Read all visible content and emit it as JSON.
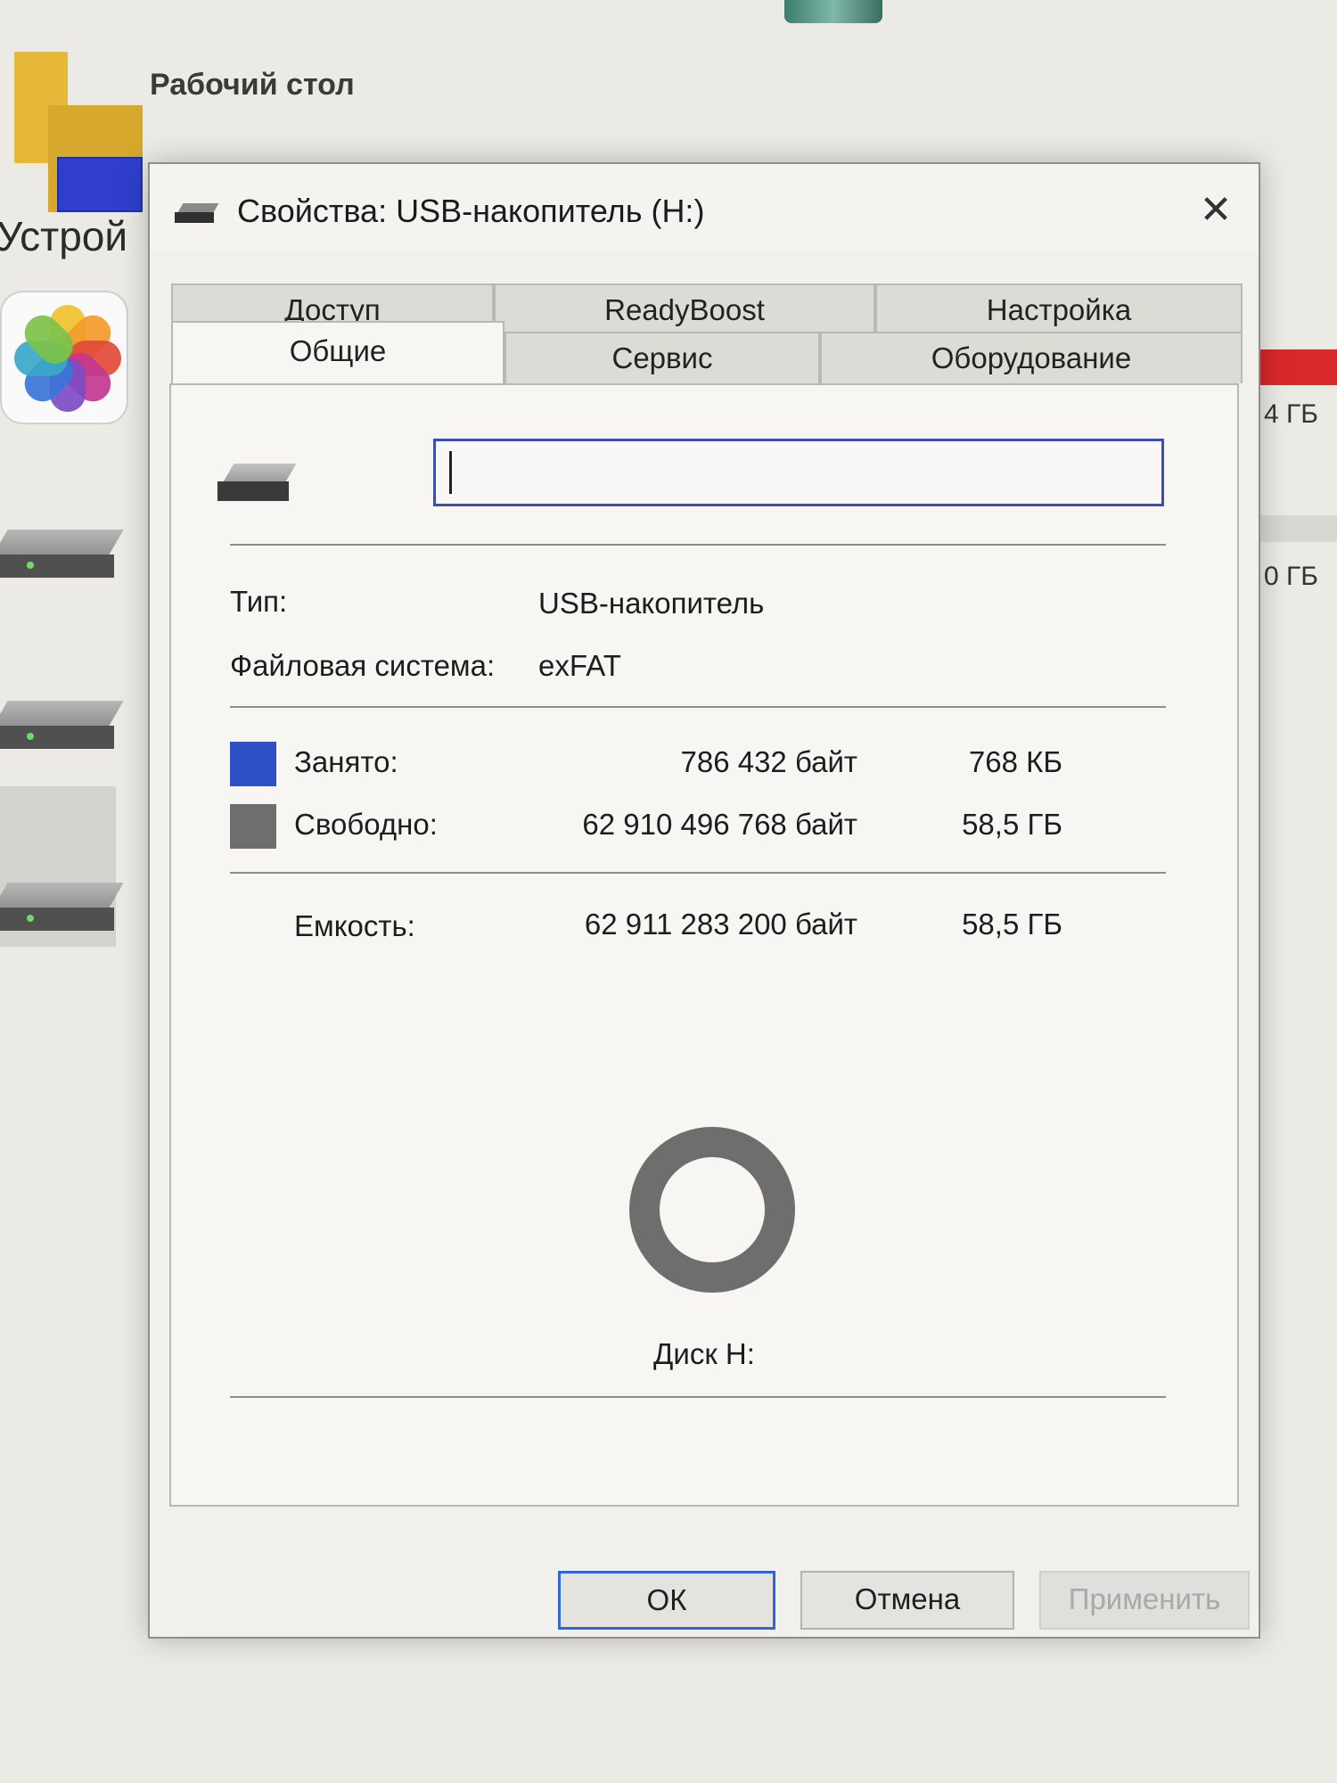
{
  "background": {
    "desktop_label": "Рабочий стол",
    "devices_label": "Устрой",
    "size_text_1": "4 ГБ",
    "size_text_2": "0 ГБ"
  },
  "dialog": {
    "title": "Свойства: USB-накопитель (H:)",
    "close_glyph": "✕",
    "tabs_back": [
      "Доступ",
      "ReadyBoost",
      "Настройка"
    ],
    "tabs_front": [
      "Общие",
      "Сервис",
      "Оборудование"
    ],
    "active_tab": "Общие",
    "name_value": "",
    "type_label": "Тип:",
    "type_value": "USB-накопитель",
    "fs_label": "Файловая система:",
    "fs_value": "exFAT",
    "used": {
      "label": "Занято:",
      "bytes": "786 432 байт",
      "size": "768 КБ",
      "color": "#2f4fc6"
    },
    "free": {
      "label": "Свободно:",
      "bytes": "62 910 496 768 байт",
      "size": "58,5 ГБ",
      "color": "#6e6e6e"
    },
    "capacity": {
      "label": "Емкость:",
      "bytes": "62 911 283 200 байт",
      "size": "58,5 ГБ"
    },
    "used_fraction": 1.25e-05,
    "disk_label": "Диск H:",
    "buttons": {
      "ok": "ОК",
      "cancel": "Отмена",
      "apply": "Применить"
    }
  }
}
